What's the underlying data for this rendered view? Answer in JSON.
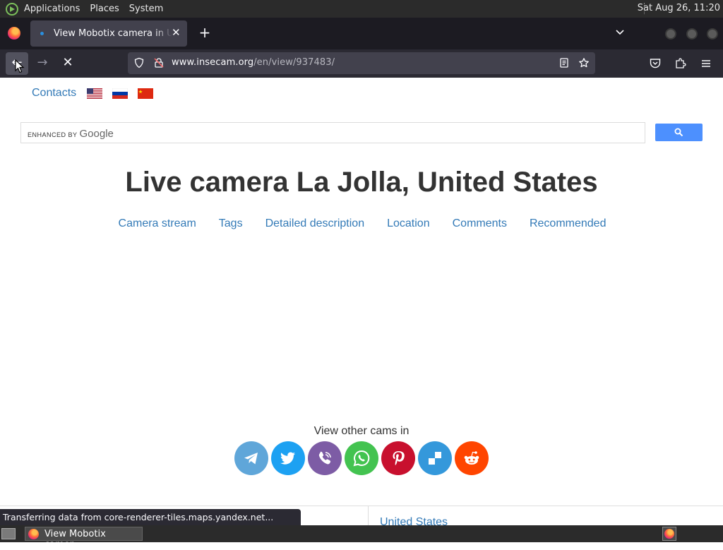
{
  "panel": {
    "menus": [
      "Applications",
      "Places",
      "System"
    ],
    "clock": "Sat Aug 26, 11:20"
  },
  "browser": {
    "tab_title": "View Mobotix camera in United States",
    "url_host": "www.insecam.org",
    "url_path": "/en/view/937483/",
    "status_text": "Transferring data from core-renderer-tiles.maps.yandex.net..."
  },
  "page": {
    "contacts_label": "Contacts",
    "flags": [
      "us-flag",
      "ru-flag",
      "cn-flag"
    ],
    "search": {
      "brand_prefix": "ENHANCED BY",
      "brand_name": "Google",
      "value": ""
    },
    "title": "Live camera La Jolla, United States",
    "section_links": [
      "Camera stream",
      "Tags",
      "Detailed description",
      "Location",
      "Comments",
      "Recommended"
    ],
    "view_other": "View other cams in",
    "share_buttons": [
      {
        "name": "telegram",
        "color": "#5fa6d9"
      },
      {
        "name": "twitter",
        "color": "#1da1f2"
      },
      {
        "name": "viber",
        "color": "#7d5ca5"
      },
      {
        "name": "whatsapp",
        "color": "#43c350"
      },
      {
        "name": "pinterest",
        "color": "#c8102e"
      },
      {
        "name": "delicious",
        "color": "#3498db"
      },
      {
        "name": "reddit",
        "color": "#ff4500"
      }
    ],
    "country_link": "United States"
  },
  "taskbar": {
    "window_label": "View Mobotix camer..."
  },
  "colors": {
    "link": "#337ab7",
    "search_button": "#4d90fe",
    "panel_bg": "#2b2b2b",
    "toolbar_bg": "#2b2a33",
    "tab_strip_bg": "#1c1b22"
  }
}
